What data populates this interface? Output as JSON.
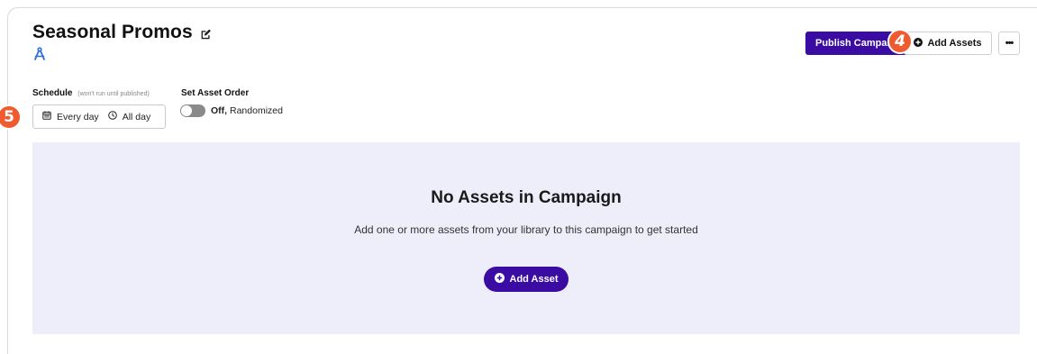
{
  "header": {
    "title": "Seasonal Promos",
    "edit_icon": "edit-icon",
    "brand_icon": "drafting-compass-icon"
  },
  "toolbar": {
    "publish_label": "Publish Campaign",
    "add_assets_label": "Add Assets",
    "more_label": "•••"
  },
  "badges": {
    "add_assets_step": "4",
    "schedule_step": "5"
  },
  "schedule": {
    "label": "Schedule",
    "hint": "(won't run until published)",
    "days": "Every day",
    "hours": "All day"
  },
  "asset_order": {
    "label": "Set Asset Order",
    "state": "Off,",
    "mode": "Randomized",
    "enabled": false
  },
  "empty_state": {
    "title": "No Assets in Campaign",
    "subtitle": "Add one or more assets from your library to this campaign to get started",
    "button_label": "Add Asset"
  },
  "colors": {
    "primary": "#3a0ca3",
    "badge": "#ef5a2e",
    "panel": "#eeeefb"
  }
}
